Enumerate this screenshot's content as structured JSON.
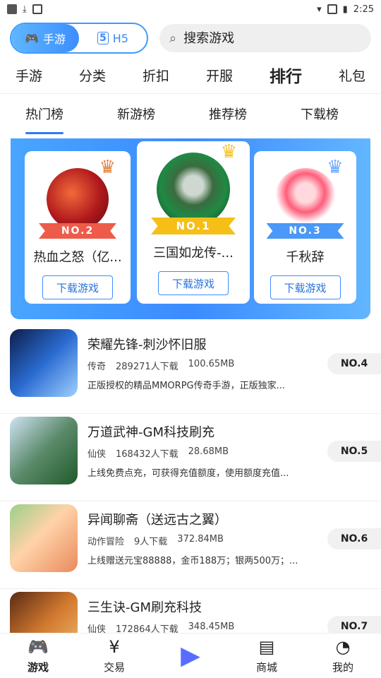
{
  "status": {
    "time": "2:25"
  },
  "toggle": {
    "mobile": "手游",
    "h5": "H5"
  },
  "search": {
    "placeholder": "搜索游戏"
  },
  "categories": [
    "手游",
    "分类",
    "折扣",
    "开服",
    "排行",
    "礼包"
  ],
  "rank_tabs": [
    "热门榜",
    "新游榜",
    "推荐榜",
    "下载榜"
  ],
  "podium": [
    {
      "rank_label": "NO.2",
      "name": "热血之怒（亿...",
      "button": "下载游戏"
    },
    {
      "rank_label": "NO.1",
      "name": "三国如龙传-...",
      "button": "下载游戏"
    },
    {
      "rank_label": "NO.3",
      "name": "千秋辞",
      "button": "下载游戏"
    }
  ],
  "games": [
    {
      "title": "荣耀先锋-刺沙怀旧服",
      "genre": "传奇",
      "downloads": "289271人下载",
      "size": "100.65MB",
      "desc": "正版授权的精品MMORPG传奇手游，正版独家...",
      "rank": "NO.4"
    },
    {
      "title": "万道武神-GM科技刷充",
      "genre": "仙侠",
      "downloads": "168432人下载",
      "size": "28.68MB",
      "desc": "上线免费点充，可获得充值额度，使用额度充值...",
      "rank": "NO.5"
    },
    {
      "title": "异闻聊斋（送远古之翼）",
      "genre": "动作冒险",
      "downloads": "9人下载",
      "size": "372.84MB",
      "desc": "上线赠送元宝88888，金币188万；银两500万；...",
      "rank": "NO.6"
    },
    {
      "title": "三生诀-GM刷充科技",
      "genre": "仙侠",
      "downloads": "172864人下载",
      "size": "348.45MB",
      "desc": "",
      "rank": "NO.7"
    }
  ],
  "bottom_nav": [
    {
      "label": "游戏",
      "icon": "gamepad-icon"
    },
    {
      "label": "交易",
      "icon": "trade-icon"
    },
    {
      "label": "",
      "icon": "play-icon"
    },
    {
      "label": "商城",
      "icon": "store-icon"
    },
    {
      "label": "我的",
      "icon": "user-icon"
    }
  ],
  "colors": {
    "accent": "#3d8dff",
    "podium_bg": "#49a5ff"
  }
}
